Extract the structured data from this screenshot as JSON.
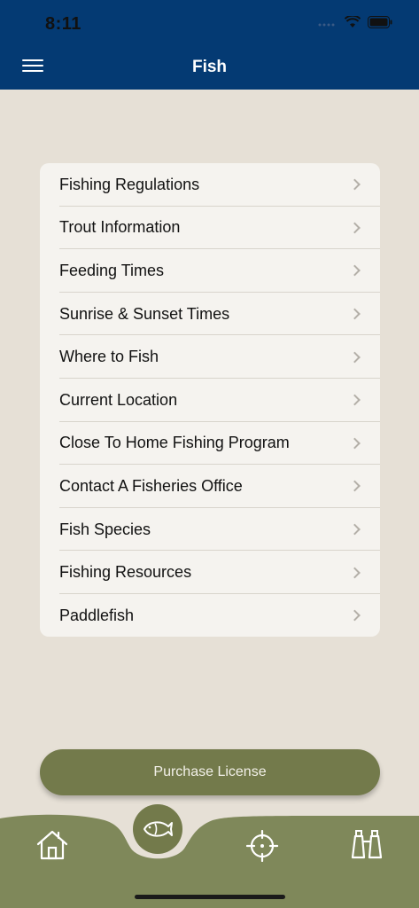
{
  "status": {
    "time": "8:11"
  },
  "header": {
    "title": "Fish",
    "menu_icon": "hamburger-icon"
  },
  "menu": {
    "items": [
      {
        "label": "Fishing Regulations"
      },
      {
        "label": "Trout Information"
      },
      {
        "label": "Feeding Times"
      },
      {
        "label": "Sunrise & Sunset Times"
      },
      {
        "label": "Where to Fish"
      },
      {
        "label": "Current Location"
      },
      {
        "label": "Close To Home Fishing Program"
      },
      {
        "label": "Contact A Fisheries Office"
      },
      {
        "label": "Fish Species"
      },
      {
        "label": "Fishing Resources"
      },
      {
        "label": "Paddlefish"
      }
    ]
  },
  "purchase": {
    "label": "Purchase License"
  },
  "tabs": [
    {
      "icon": "home-icon"
    },
    {
      "icon": "fish-icon",
      "active": true
    },
    {
      "icon": "crosshair-icon"
    },
    {
      "icon": "binoculars-icon"
    }
  ],
  "colors": {
    "header": "#043a73",
    "background": "#e6e0d6",
    "card": "#f5f3ef",
    "button": "#737a4b",
    "tab_bar": "#7f885a"
  }
}
